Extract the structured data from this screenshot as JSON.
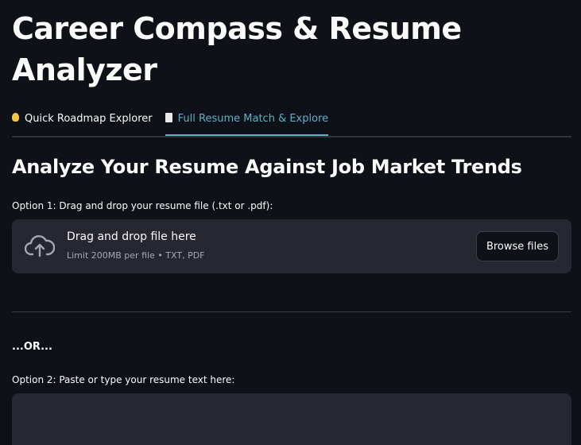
{
  "app": {
    "title": "Career Compass & Resume Analyzer"
  },
  "tabs": [
    {
      "icon": "lightbulb-icon",
      "label": "Quick Roadmap Explorer",
      "active": false
    },
    {
      "icon": "document-icon",
      "label": "Full Resume Match & Explore",
      "active": true
    }
  ],
  "main": {
    "heading": "Analyze Your Resume Against Job Market Trends",
    "option1_label": "Option 1: Drag and drop your resume file (.txt or .pdf):",
    "uploader": {
      "icon": "cloud-upload-icon",
      "title": "Drag and drop file here",
      "limit": "Limit 200MB per file • TXT, PDF",
      "browse_label": "Browse files"
    },
    "or_text": "...OR...",
    "option2_label": "Option 2: Paste or type your resume text here:",
    "resume_text": {
      "value": "",
      "placeholder": ""
    }
  },
  "colors": {
    "background": "#0e1117",
    "surface": "#262730",
    "accent": "#5fb1c9",
    "text": "#fafafa",
    "muted": "#a3a8b4"
  }
}
